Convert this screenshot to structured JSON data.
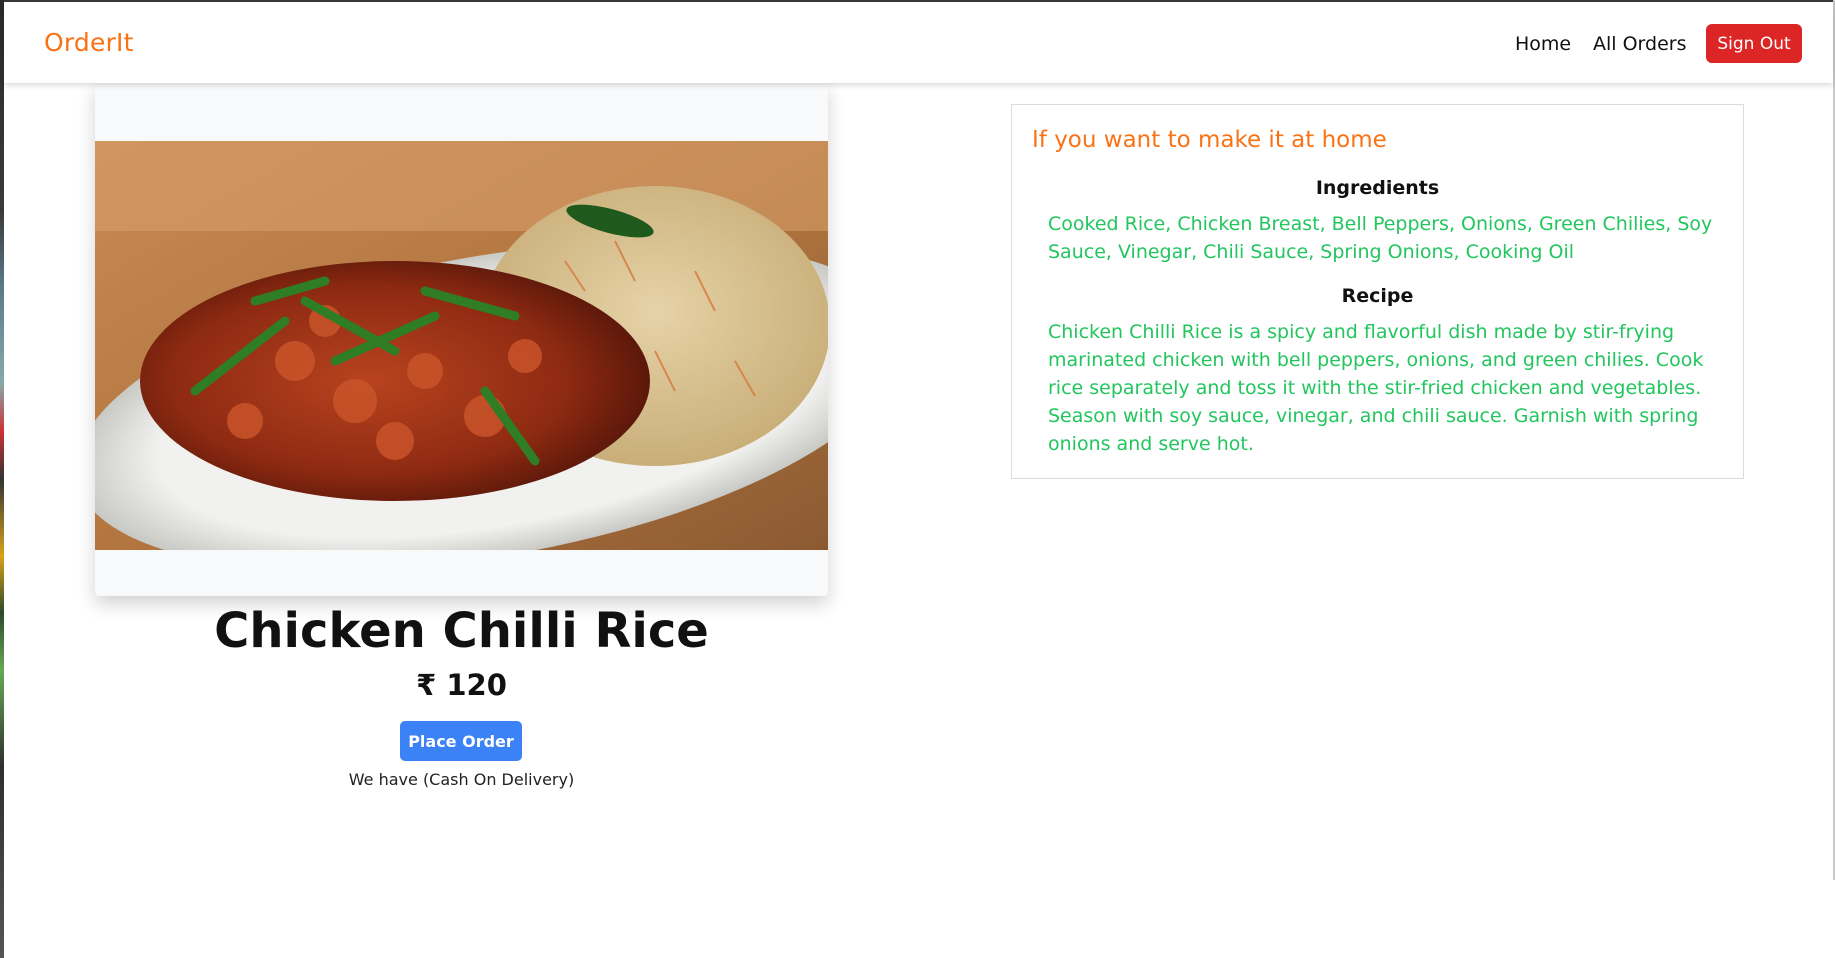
{
  "navbar": {
    "brand": "OrderIt",
    "links": [
      "Home",
      "All Orders"
    ],
    "sign_out": "Sign Out"
  },
  "dish": {
    "name": "Chicken Chilli Rice",
    "price": "₹ 120",
    "order_button": "Place Order",
    "payment_note": "We have (Cash On Delivery)",
    "image_icon": "food-photo"
  },
  "recipe_card": {
    "heading": "If you want to make it at home",
    "ingredients_title": "Ingredients",
    "ingredients": "Cooked Rice, Chicken Breast, Bell Peppers, Onions, Green Chilies, Soy Sauce, Vinegar, Chili Sauce, Spring Onions, Cooking Oil",
    "recipe_title": "Recipe",
    "recipe": "Chicken Chilli Rice is a spicy and flavorful dish made by stir-frying marinated chicken with bell peppers, onions, and green chilies. Cook rice separately and toss it with the stir-fried chicken and vegetables. Season with soy sauce, vinegar, and chili sauce. Garnish with spring onions and serve hot."
  },
  "colors": {
    "brand": "#f97316",
    "sign_out": "#dc2626",
    "order_button": "#3b82f6",
    "recipe_text": "#22c55e"
  }
}
